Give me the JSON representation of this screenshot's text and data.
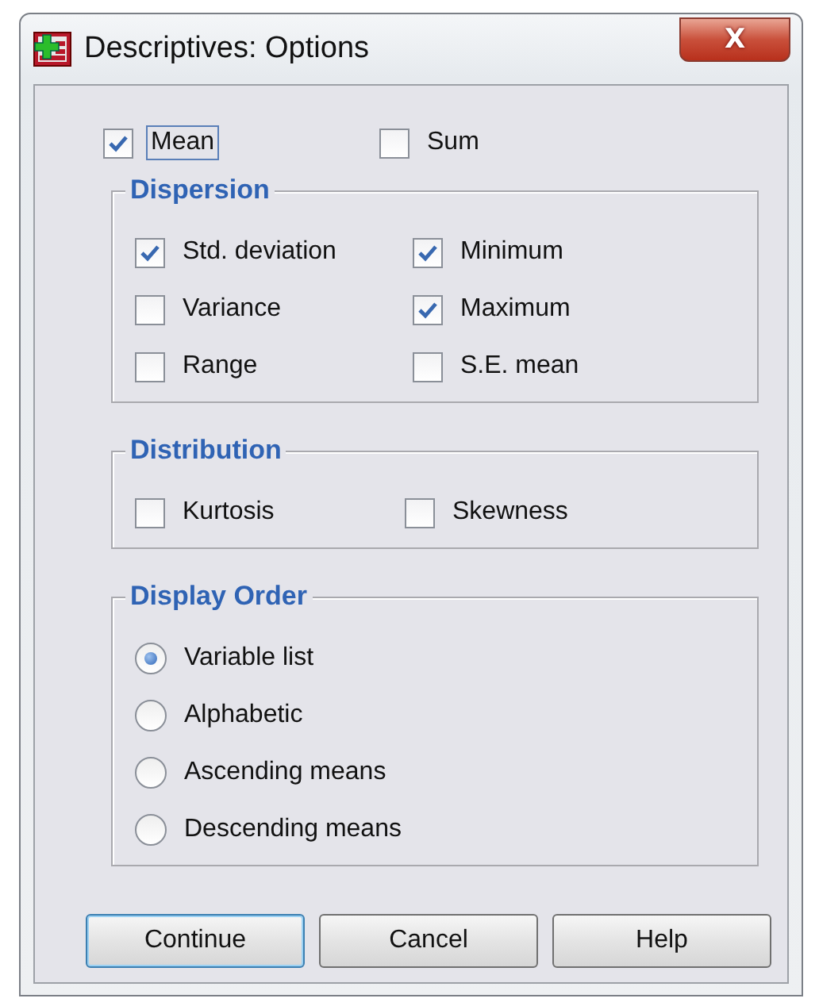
{
  "window": {
    "title": "Descriptives: Options",
    "close_label": "X"
  },
  "top_options": [
    {
      "label": "Mean",
      "checked": true,
      "focused": true
    },
    {
      "label": "Sum",
      "checked": false,
      "focused": false
    }
  ],
  "groups": [
    {
      "title": "Dispersion",
      "kind": "checks",
      "items": [
        {
          "label": "Std. deviation",
          "checked": true
        },
        {
          "label": "Minimum",
          "checked": true
        },
        {
          "label": "Variance",
          "checked": false
        },
        {
          "label": "Maximum",
          "checked": true
        },
        {
          "label": "Range",
          "checked": false
        },
        {
          "label": "S.E. mean",
          "checked": false
        }
      ]
    },
    {
      "title": "Distribution",
      "kind": "checks",
      "items": [
        {
          "label": "Kurtosis",
          "checked": false
        },
        {
          "label": "Skewness",
          "checked": false
        }
      ]
    },
    {
      "title": "Display Order",
      "kind": "radios",
      "items": [
        {
          "label": "Variable list",
          "selected": true
        },
        {
          "label": "Alphabetic",
          "selected": false
        },
        {
          "label": "Ascending means",
          "selected": false
        },
        {
          "label": "Descending means",
          "selected": false
        }
      ]
    }
  ],
  "buttons": [
    {
      "label": "Continue",
      "default": true
    },
    {
      "label": "Cancel",
      "default": false
    },
    {
      "label": "Help",
      "default": false
    }
  ]
}
